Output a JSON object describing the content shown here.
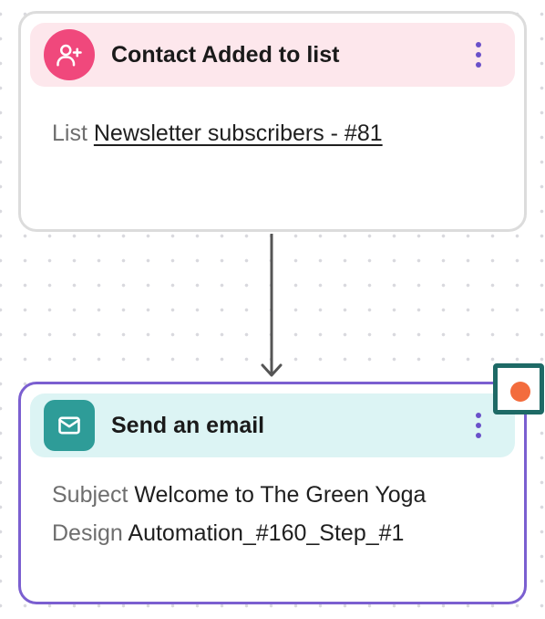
{
  "trigger_card": {
    "title": "Contact Added to list",
    "icon": "user-plus-icon",
    "list_label": "List",
    "list_value": "Newsletter subscribers - #81"
  },
  "action_card": {
    "title": "Send an email",
    "icon": "mail-icon",
    "subject_label": "Subject",
    "subject_value": "Welcome to The Green Yoga",
    "design_label": "Design",
    "design_value": "Automation_#160_Step_#1"
  },
  "colors": {
    "trigger_header_bg": "#fde7ec",
    "trigger_icon_bg": "#f0487c",
    "action_header_bg": "#dcf4f4",
    "action_icon_bg": "#2e9c98",
    "selected_border": "#7b5fd0",
    "kebab": "#6a50c9",
    "status_dot": "#f36c3d",
    "handle_border": "#1e6a66"
  }
}
